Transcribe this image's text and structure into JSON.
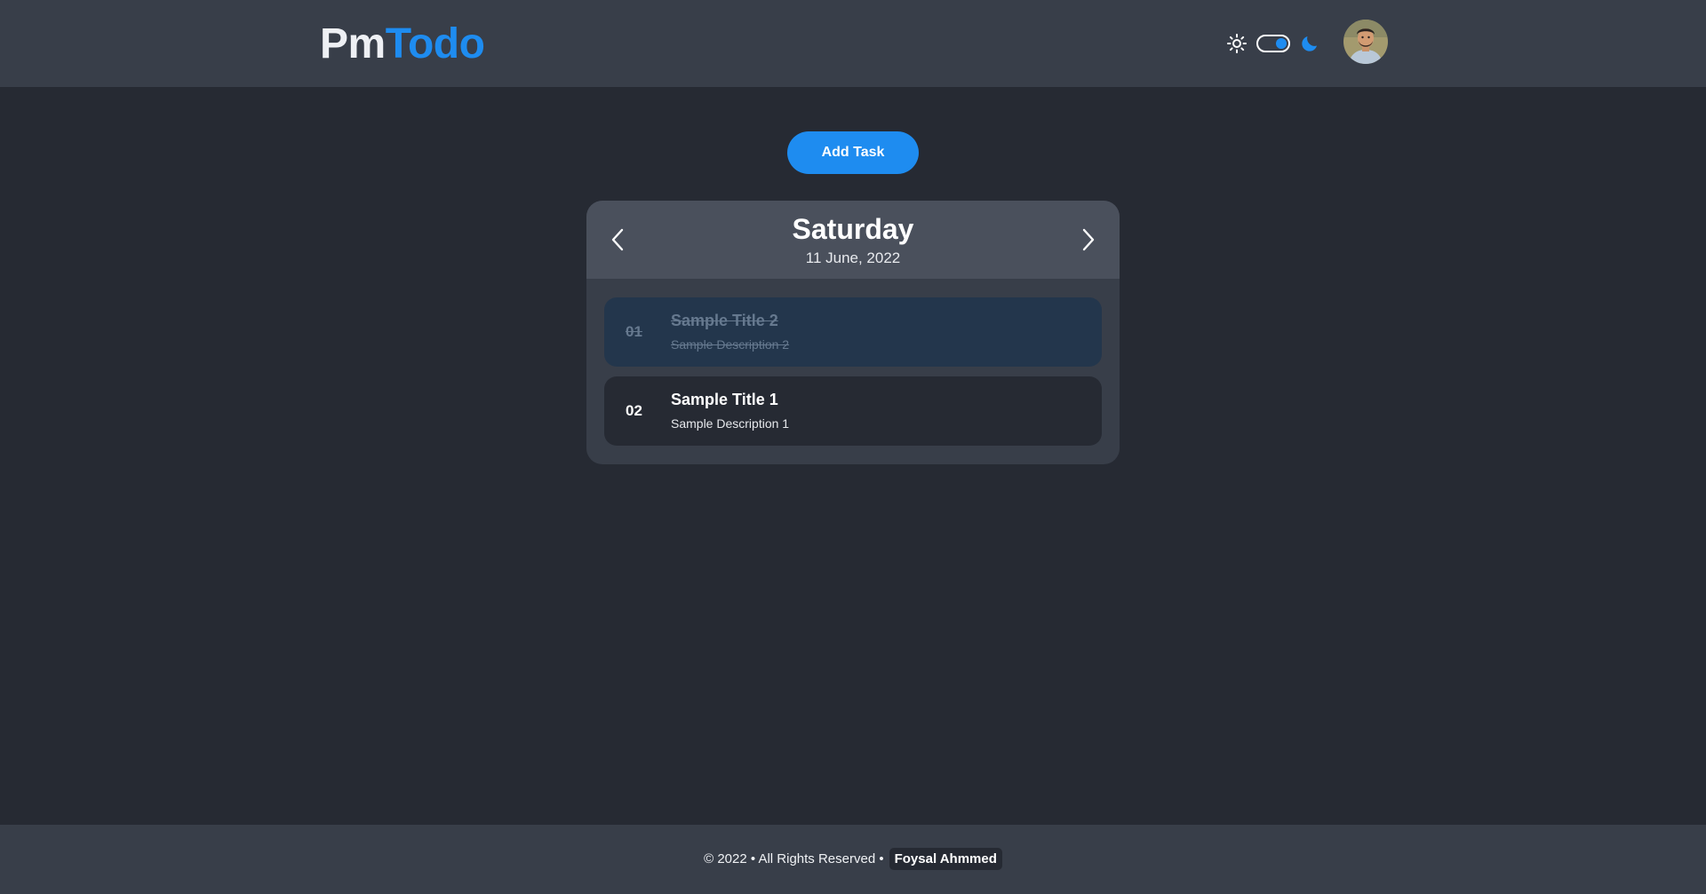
{
  "header": {
    "logo_part1": "Pm",
    "logo_part2": "Todo",
    "theme": {
      "light_icon": "sun-icon",
      "dark_icon": "moon-icon",
      "mode": "dark",
      "toggle_on": true
    },
    "avatar_icon": "user-avatar"
  },
  "main": {
    "add_task_label": "Add Task",
    "day": {
      "name": "Saturday",
      "date": "11 June, 2022",
      "prev_icon": "chevron-left-icon",
      "next_icon": "chevron-right-icon"
    },
    "tasks": [
      {
        "number": "01",
        "title": "Sample Title 2",
        "description": "Sample Description 2",
        "completed": true
      },
      {
        "number": "02",
        "title": "Sample Title 1",
        "description": "Sample Description 1",
        "completed": false
      }
    ]
  },
  "footer": {
    "copyright": "© 2022 • All Rights Reserved •",
    "author": "Foysal Ahmmed"
  },
  "colors": {
    "accent": "#1e8cf0",
    "background": "#262a33",
    "surface": "#383e49",
    "card_header": "#4a505c",
    "completed_task": "#23364c"
  }
}
